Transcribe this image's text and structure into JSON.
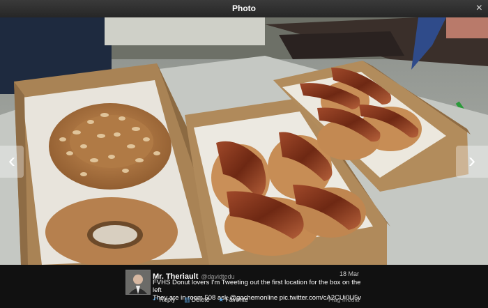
{
  "viewer": {
    "title": "Photo",
    "close_glyph": "×",
    "prev_glyph": "‹",
    "next_glyph": "›"
  },
  "tweet": {
    "name": "Mr. Theriault",
    "handle": "@davidtedu",
    "date": "18 Mar",
    "line1": "FVHS Donut lovers I'm Tweeting out the first location for the box on the left",
    "line2": "They are in room 508 ask @gochemonline pic.twitter.com/cA2CUi0U5v"
  },
  "actions": {
    "reply": "Reply",
    "delete": "Delete",
    "favorite": "Favorite",
    "flag": "Flag media"
  },
  "icons": {
    "reply": "reply-icon",
    "delete": "trash-icon",
    "favorite": "star-icon"
  },
  "colors": {
    "link": "#5aa3e0"
  }
}
